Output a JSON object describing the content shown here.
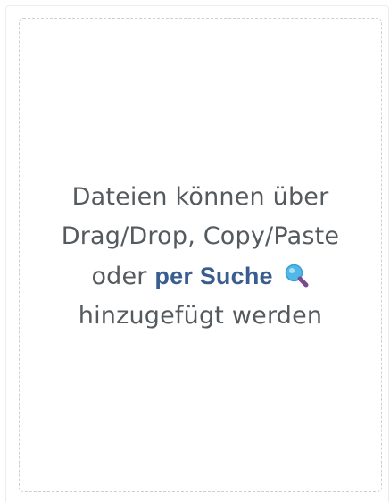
{
  "upload": {
    "line1": "Dateien können über",
    "line2": "Drag/Drop, Copy/Paste",
    "line3_prefix": "oder",
    "search_link": "per Suche",
    "line4": "hinzugefügt werden",
    "icon": "search-icon",
    "link_color": "#3a5d8f",
    "icon_fill": "#4fb8e8",
    "icon_handle": "#7b4a8c"
  }
}
